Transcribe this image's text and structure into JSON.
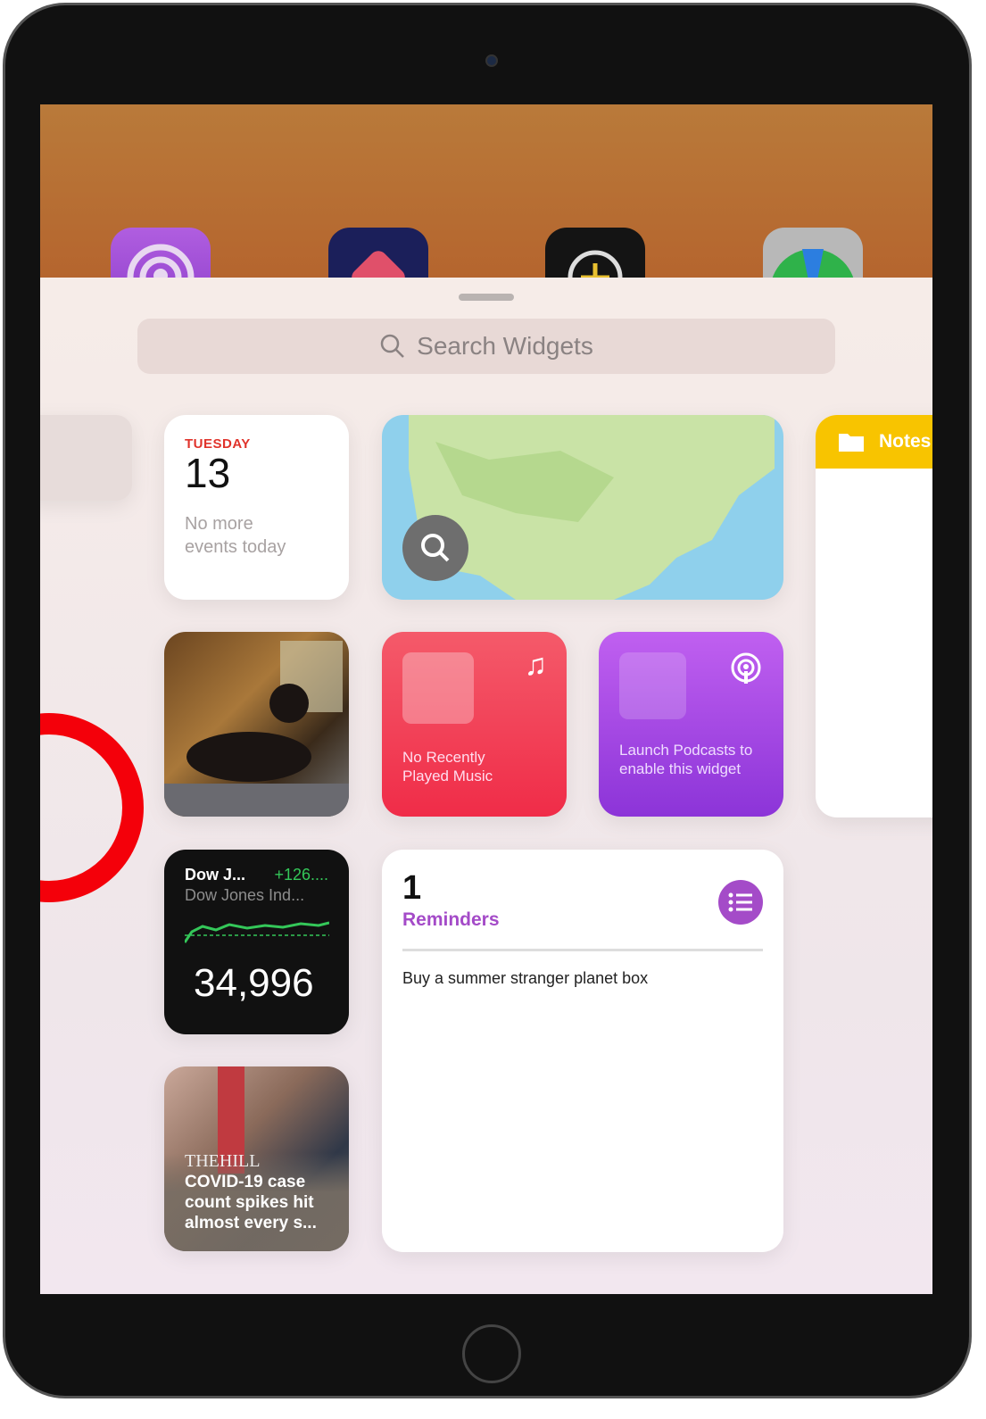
{
  "search": {
    "placeholder": "Search Widgets",
    "icon": "search-icon"
  },
  "calendar": {
    "day": "TUESDAY",
    "date": "13",
    "message": "No more events today"
  },
  "notes": {
    "title": "Notes"
  },
  "music": {
    "message": "No Recently Played Music"
  },
  "podcasts": {
    "message": "Launch Podcasts to enable this widget"
  },
  "stocks": {
    "symbol": "Dow J...",
    "change": "+126....",
    "name": "Dow Jones Ind...",
    "value": "34,996",
    "change_color": "#34c759"
  },
  "reminders": {
    "count": "1",
    "title": "Reminders",
    "items": [
      "Buy a summer stranger planet box"
    ],
    "accent": "#a44bc8"
  },
  "news": {
    "source": "THEHILL",
    "headline": "COVID-19 case count spikes hit almost every s..."
  },
  "colors": {
    "calendar_red": "#e0332b",
    "music": "#f03350",
    "podcasts": "#9a3fe0"
  }
}
